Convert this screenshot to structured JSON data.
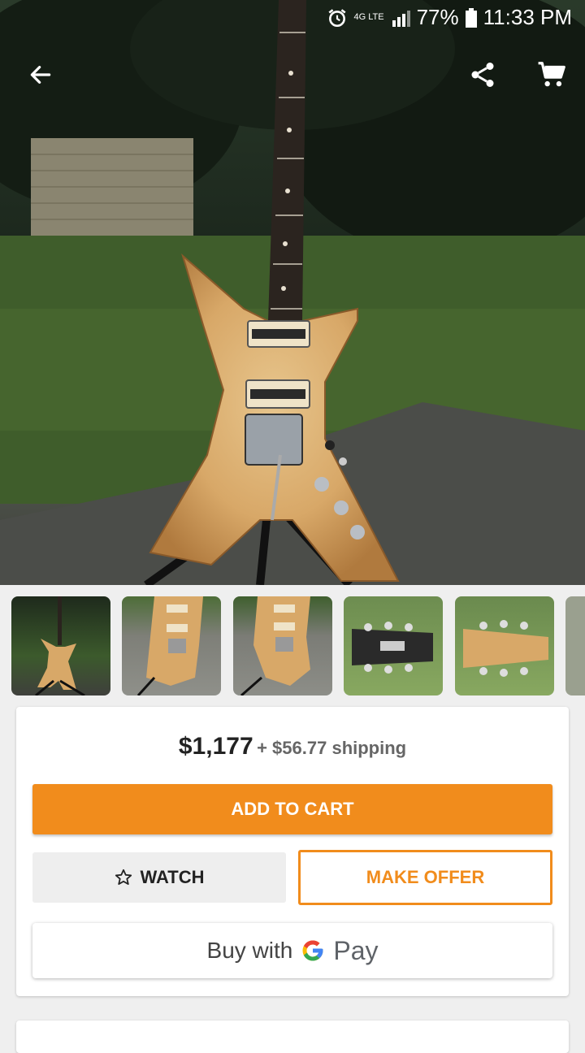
{
  "status_bar": {
    "battery": "77%",
    "time": "11:33 PM",
    "network": "4G LTE"
  },
  "app_bar": {
    "back_icon": "arrow-back-icon",
    "share_icon": "share-icon",
    "cart_icon": "shopping-cart-icon"
  },
  "listing": {
    "price": "$1,177",
    "shipping": "+ $56.77 shipping",
    "add_to_cart_label": "ADD TO CART",
    "watch_label": "WATCH",
    "make_offer_label": "MAKE OFFER",
    "buy_with_label": "Buy with",
    "gpay_label": "Pay"
  },
  "colors": {
    "accent": "#f18c1c",
    "google_blue": "#4285f4",
    "google_red": "#ea4335",
    "google_yellow": "#fbbc05",
    "google_green": "#34a853"
  }
}
